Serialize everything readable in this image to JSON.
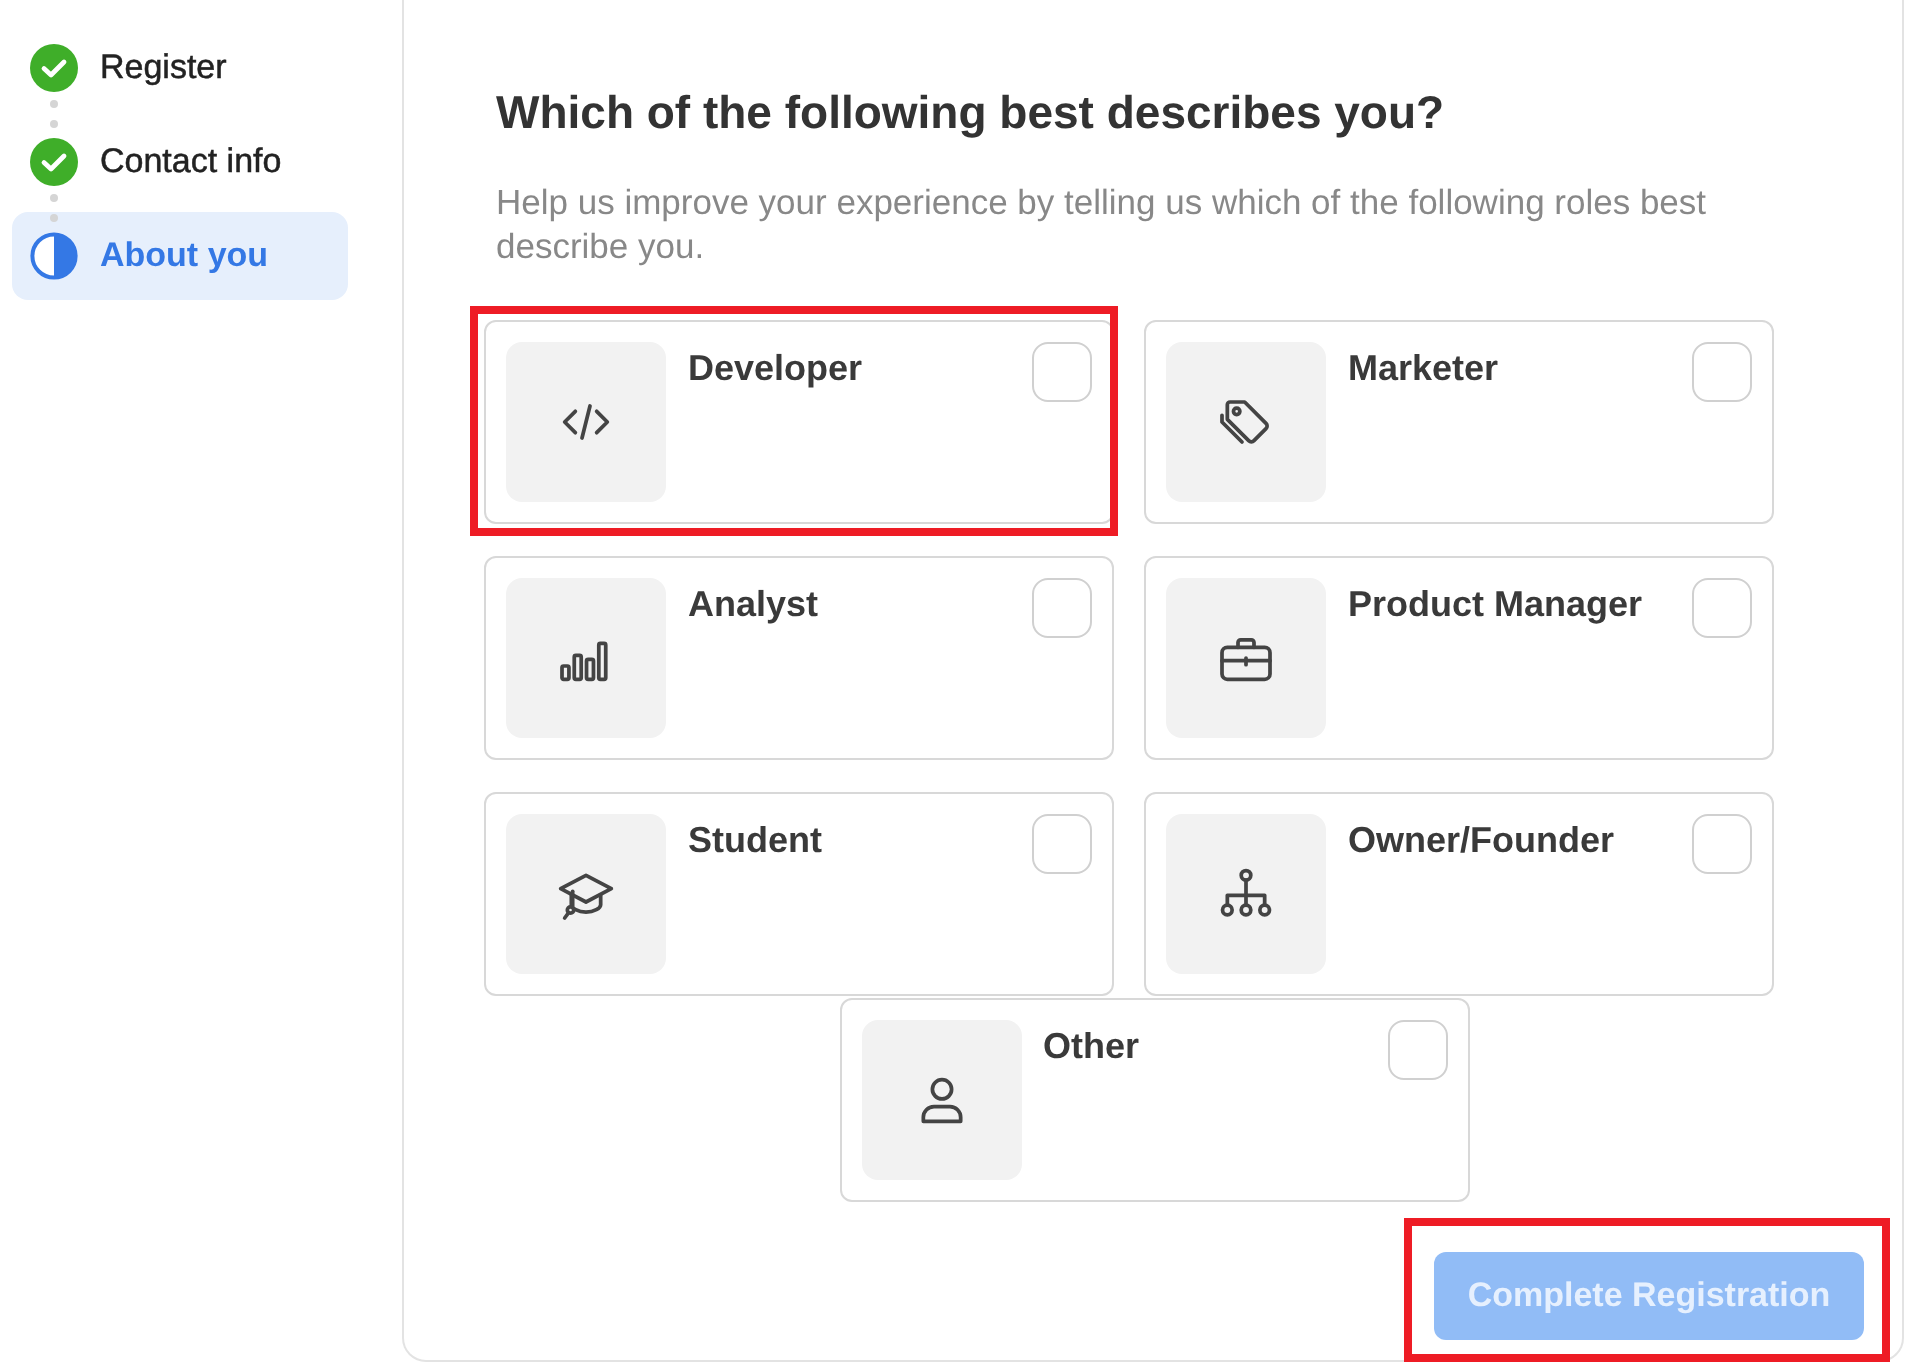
{
  "steps": [
    {
      "label": "Register",
      "completed": true,
      "selected": false
    },
    {
      "label": "Contact info",
      "completed": true,
      "selected": false
    },
    {
      "label": "About you",
      "completed": false,
      "selected": true
    }
  ],
  "question": {
    "title": "Which of the following best describes you?",
    "description": "Help us improve your experience by telling us which of the following roles best describe you."
  },
  "options": [
    {
      "label": "Developer",
      "checked": false,
      "highlighted": true
    },
    {
      "label": "Marketer",
      "checked": false,
      "highlighted": false
    },
    {
      "label": "Analyst",
      "checked": false,
      "highlighted": false
    },
    {
      "label": "Product Manager",
      "checked": false,
      "highlighted": false
    },
    {
      "label": "Student",
      "checked": false,
      "highlighted": false
    },
    {
      "label": "Owner/Founder",
      "checked": false,
      "highlighted": false
    },
    {
      "label": "Other",
      "checked": false,
      "highlighted": false
    }
  ],
  "submit_button": {
    "label": "Complete Registration",
    "disabled": true,
    "highlighted": true
  }
}
